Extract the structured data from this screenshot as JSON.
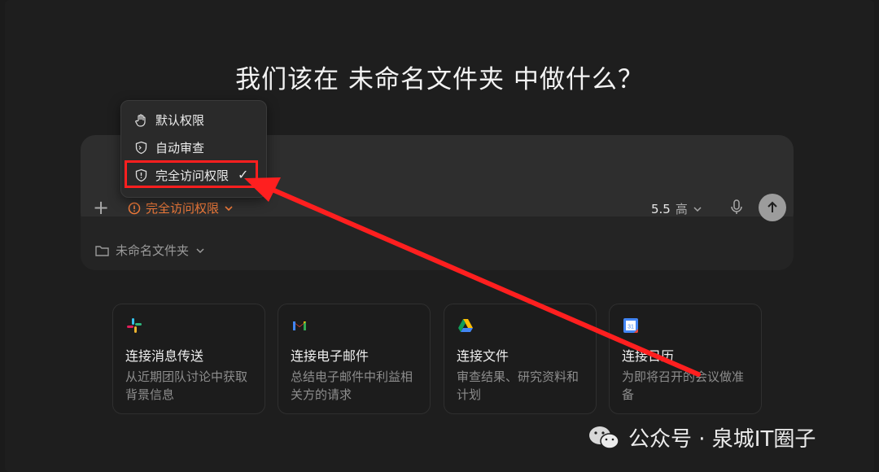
{
  "heading": "我们该在 未命名文件夹 中做什么？",
  "permission_menu": {
    "items": [
      {
        "label": "默认权限",
        "icon": "hand-icon"
      },
      {
        "label": "自动审查",
        "icon": "terminal-shield-icon"
      },
      {
        "label": "完全访问权限",
        "icon": "shield-alert-icon",
        "selected": true
      }
    ],
    "check": "✓"
  },
  "composer": {
    "permission_label": "完全访问权限",
    "model_version": "5.5",
    "effort": "高",
    "folder": "未命名文件夹"
  },
  "cards": [
    {
      "title": "连接消息传送",
      "desc": "从近期团队讨论中获取背景信息",
      "icon": "slack-icon"
    },
    {
      "title": "连接电子邮件",
      "desc": "总结电子邮件中利益相关方的请求",
      "icon": "gmail-icon"
    },
    {
      "title": "连接文件",
      "desc": "审查结果、研究资料和计划",
      "icon": "google-drive-icon"
    },
    {
      "title": "连接日历",
      "desc": "为即将召开的会议做准备",
      "icon": "google-calendar-icon",
      "icon_text": "31"
    }
  ],
  "watermark": "公众号 · 泉城IT圈子",
  "colors": {
    "accent": "#f07a3a",
    "annotation": "#ff1f1f",
    "bg": "#1e1e1e"
  }
}
